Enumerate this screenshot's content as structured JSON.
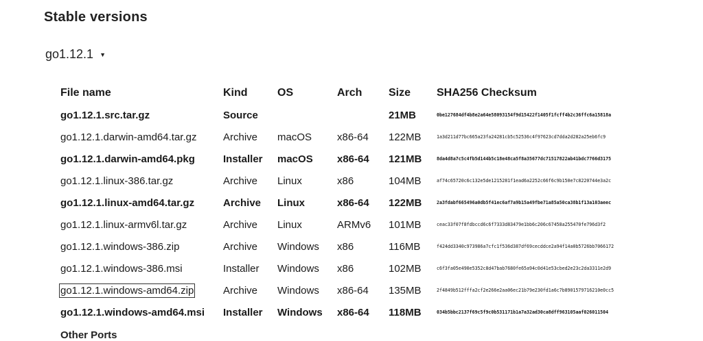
{
  "section_title": "Stable versions",
  "version": {
    "label": "go1.12.1",
    "caret": "▼"
  },
  "table": {
    "headers": [
      "File name",
      "Kind",
      "OS",
      "Arch",
      "Size",
      "SHA256 Checksum"
    ],
    "rows": [
      {
        "file": "go1.12.1.src.tar.gz",
        "kind": "Source",
        "os": "",
        "arch": "",
        "size": "21MB",
        "checksum": "0be127684df4b8e2a64e58093154f9d15422f1405f1fcff4b2c36ffc6a15818a",
        "highlight": true
      },
      {
        "file": "go1.12.1.darwin-amd64.tar.gz",
        "kind": "Archive",
        "os": "macOS",
        "arch": "x86-64",
        "size": "122MB",
        "checksum": "1a3d211d77bc665a23fa24281cb5c52536c4f97623cd7dda2d282a25eb6fc9",
        "highlight": false
      },
      {
        "file": "go1.12.1.darwin-amd64.pkg",
        "kind": "Installer",
        "os": "macOS",
        "arch": "x86-64",
        "size": "121MB",
        "checksum": "8da4d8a7c5c4fb5d144b5c18e48ca5f8a35677dc71517822ab41bdc7766d3175",
        "highlight": true
      },
      {
        "file": "go1.12.1.linux-386.tar.gz",
        "kind": "Archive",
        "os": "Linux",
        "arch": "x86",
        "size": "104MB",
        "checksum": "af74c65720c6c132e5de1215281f1ead6a2252c66f6c9b150e7c8220744e3a2c",
        "highlight": false
      },
      {
        "file": "go1.12.1.linux-amd64.tar.gz",
        "kind": "Archive",
        "os": "Linux",
        "arch": "x86-64",
        "size": "122MB",
        "checksum": "2a3fdabf665496a0db5f41ec6af7a9b15a49fbe71a85a50ca38b1f13a103aeec",
        "highlight": true
      },
      {
        "file": "go1.12.1.linux-armv6l.tar.gz",
        "kind": "Archive",
        "os": "Linux",
        "arch": "ARMv6",
        "size": "101MB",
        "checksum": "ceac33f07f8fdbccd6c6f7333d83479e1bb6c206c67458a255470fe796d3f2",
        "highlight": false
      },
      {
        "file": "go1.12.1.windows-386.zip",
        "kind": "Archive",
        "os": "Windows",
        "arch": "x86",
        "size": "116MB",
        "checksum": "f424dd3340c973986a7cfc1f536d387df69cecddce2a94f14a0b5726bb7066172",
        "highlight": false
      },
      {
        "file": "go1.12.1.windows-386.msi",
        "kind": "Installer",
        "os": "Windows",
        "arch": "x86",
        "size": "102MB",
        "checksum": "c6f3fa05e490e5352c8d47bab7680fe65a94c0d41e53cbed2e23c2da3311e2d9",
        "highlight": false
      },
      {
        "file": "go1.12.1.windows-amd64.zip",
        "kind": "Archive",
        "os": "Windows",
        "arch": "x86-64",
        "size": "135MB",
        "checksum": "2f4849b512fffa2cf2e266e2aa06ec21b79e230fd1a6c7b8901579716210e0cc5",
        "highlight": false,
        "focused": true
      },
      {
        "file": "go1.12.1.windows-amd64.msi",
        "kind": "Installer",
        "os": "Windows",
        "arch": "x86-64",
        "size": "118MB",
        "checksum": "034b5bbc2137f69c5f9c0b531171b1a7a32ad30ca8dff963105aaf026011504",
        "highlight": true
      }
    ]
  },
  "other_ports_label": "Other Ports"
}
